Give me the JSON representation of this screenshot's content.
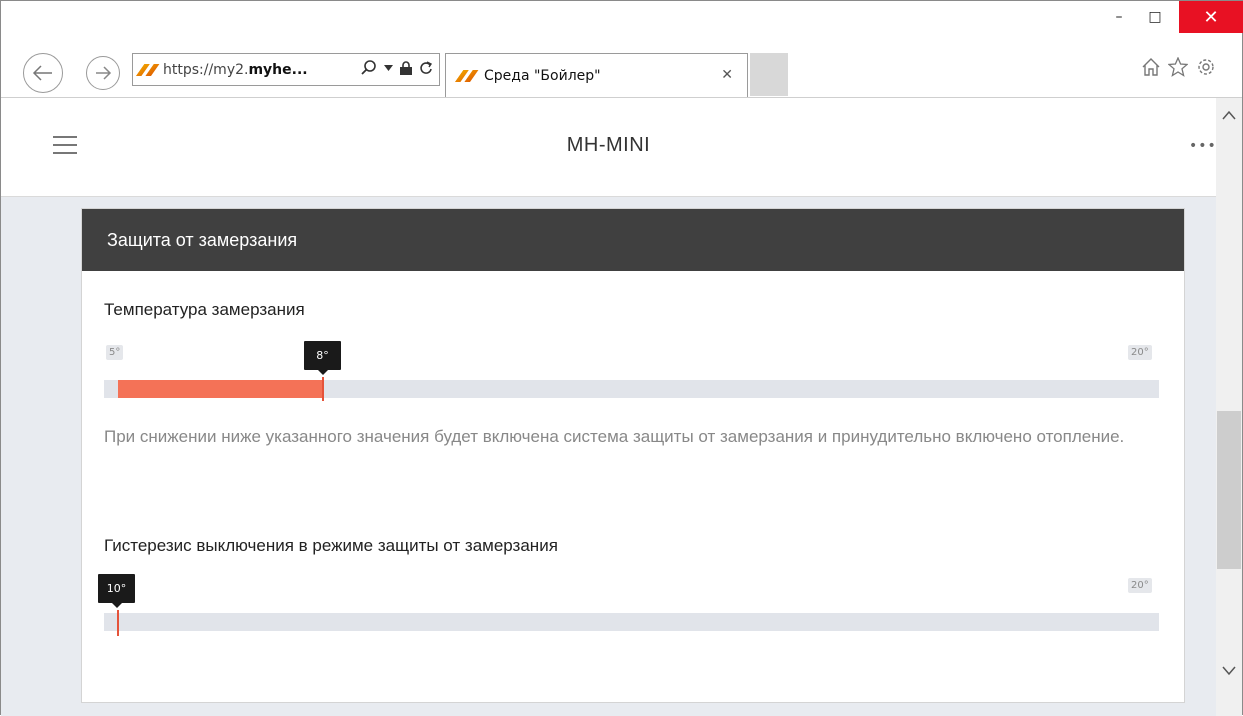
{
  "browser": {
    "address_url_prefix": "https://my2.",
    "address_url_bold": "myhe...",
    "tab_title": "Среда \"Бойлер\"",
    "window_controls": {
      "minimize": "–",
      "maximize": "□",
      "close": "✕"
    }
  },
  "app": {
    "title": "MH-MINI",
    "menu_icon": "hamburger-icon",
    "more_label": "•••"
  },
  "section": {
    "title": "Защита от замерзания",
    "freeze_temp": {
      "label": "Температура замерзания",
      "min_label": "5°",
      "max_label": "20°",
      "value_label": "8°",
      "min": 5,
      "max": 20,
      "value": 8,
      "fill_color": "#f47257"
    },
    "description": "При снижении ниже указанного значения будет включена система защиты от замерзания и принудительно включено отопление.",
    "hysteresis": {
      "label": "Гистерезис выключения в режиме защиты от замерзания",
      "max_label": "20°",
      "value_label": "10°",
      "value": 10
    }
  }
}
